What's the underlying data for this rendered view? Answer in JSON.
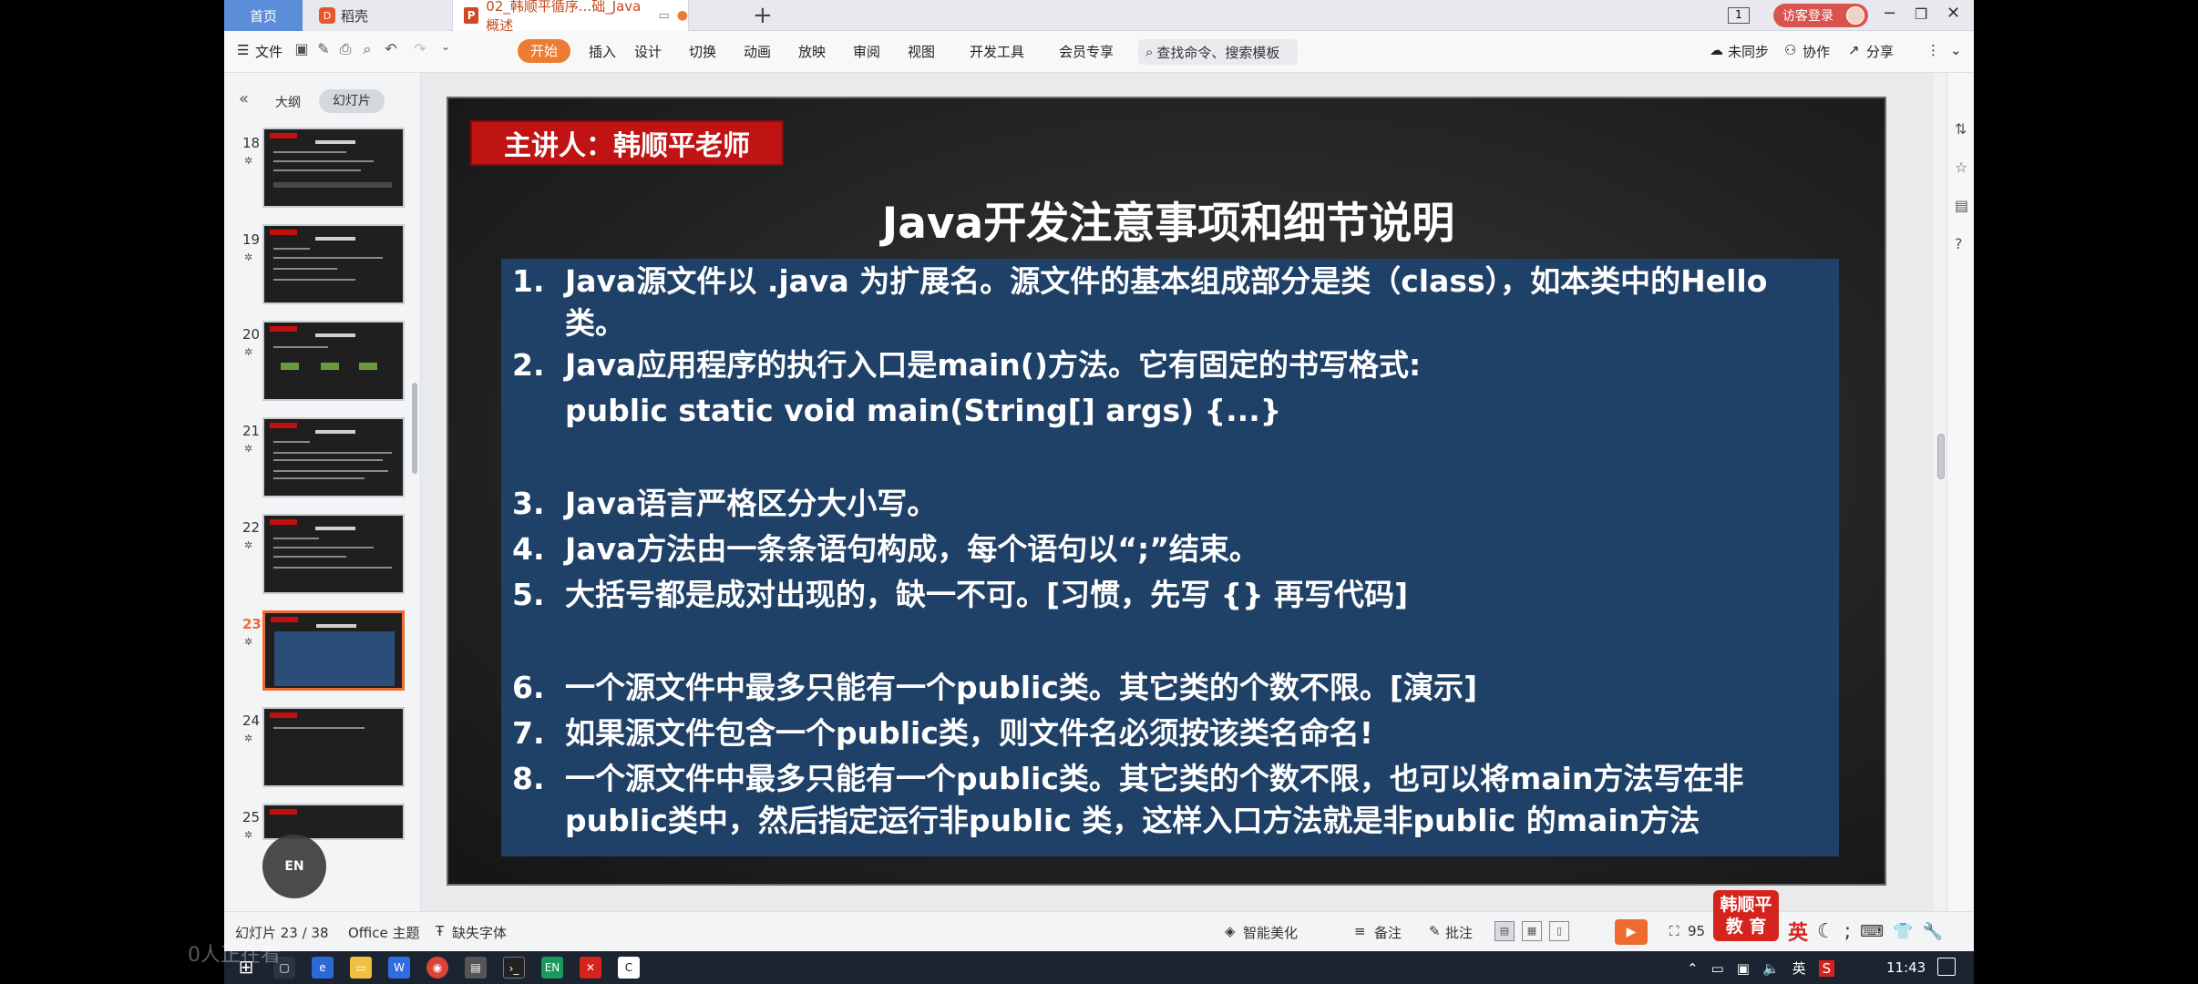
{
  "tabs": {
    "home": "首页",
    "shell": "稻壳",
    "doc": "02_韩顺平循序...础_Java概述",
    "add": "+"
  },
  "window": {
    "count": "1",
    "login": "访客登录",
    "minimize": "−",
    "restore": "❐",
    "close": "✕"
  },
  "ribbon": {
    "file": "文件",
    "menus": [
      "开始",
      "插入",
      "设计",
      "切换",
      "动画",
      "放映",
      "审阅",
      "视图",
      "开发工具",
      "会员专享"
    ],
    "search": "查找命令、搜索模板",
    "unsynced": "未同步",
    "collab": "协作",
    "share": "分享"
  },
  "leftpanel": {
    "outline": "大纲",
    "slides": "幻灯片",
    "thumbnails": [
      {
        "num": "18",
        "star": "✲"
      },
      {
        "num": "19",
        "star": "✲"
      },
      {
        "num": "20",
        "star": "✲"
      },
      {
        "num": "21",
        "star": "✲"
      },
      {
        "num": "22",
        "star": "✲"
      },
      {
        "num": "23",
        "star": "✲"
      },
      {
        "num": "24",
        "star": "✲"
      },
      {
        "num": "25",
        "star": "✲"
      }
    ],
    "badge": "EN"
  },
  "slide": {
    "presenter": "主讲人：韩顺平老师",
    "title": "Java开发注意事项和细节说明",
    "items": [
      {
        "num": "1.",
        "text": "Java源文件以 .java 为扩展名。源文件的基本组成部分是类（class），如本类中的Hello类。"
      },
      {
        "num": "2.",
        "text": "Java应用程序的执行入口是main()方法。它有固定的书写格式:"
      },
      {
        "num": "",
        "text": "public static void main(String[] args)  {...}"
      },
      {
        "num": "3.",
        "text": "Java语言严格区分大小写。"
      },
      {
        "num": "4.",
        "text": "Java方法由一条条语句构成，每个语句以“;”结束。"
      },
      {
        "num": "5.",
        "text": "大括号都是成对出现的，缺一不可。[习惯，先写 {} 再写代码]"
      },
      {
        "num": "6.",
        "text": "一个源文件中最多只能有一个public类。其它类的个数不限。[演示]"
      },
      {
        "num": "7.",
        "text": "如果源文件包含一个public类，则文件名必须按该类名命名!"
      },
      {
        "num": "8.",
        "text": "一个源文件中最多只能有一个public类。其它类的个数不限，也可以将main方法写在非public类中，然后指定运行非public 类，这样入口方法就是非public 的main方法"
      }
    ]
  },
  "status": {
    "slide_counter": "幻灯片 23 / 38",
    "theme": "Office 主题",
    "missing_font": "缺失字体",
    "beautify": "智能美化",
    "notes": "备注",
    "comments": "批注",
    "zoom": "95",
    "brand": "韩顺平教 育",
    "ime_lang": "英"
  },
  "taskbar": {
    "ime": "英",
    "time": "11:43"
  },
  "overlay": {
    "watching": "0人正在看"
  }
}
